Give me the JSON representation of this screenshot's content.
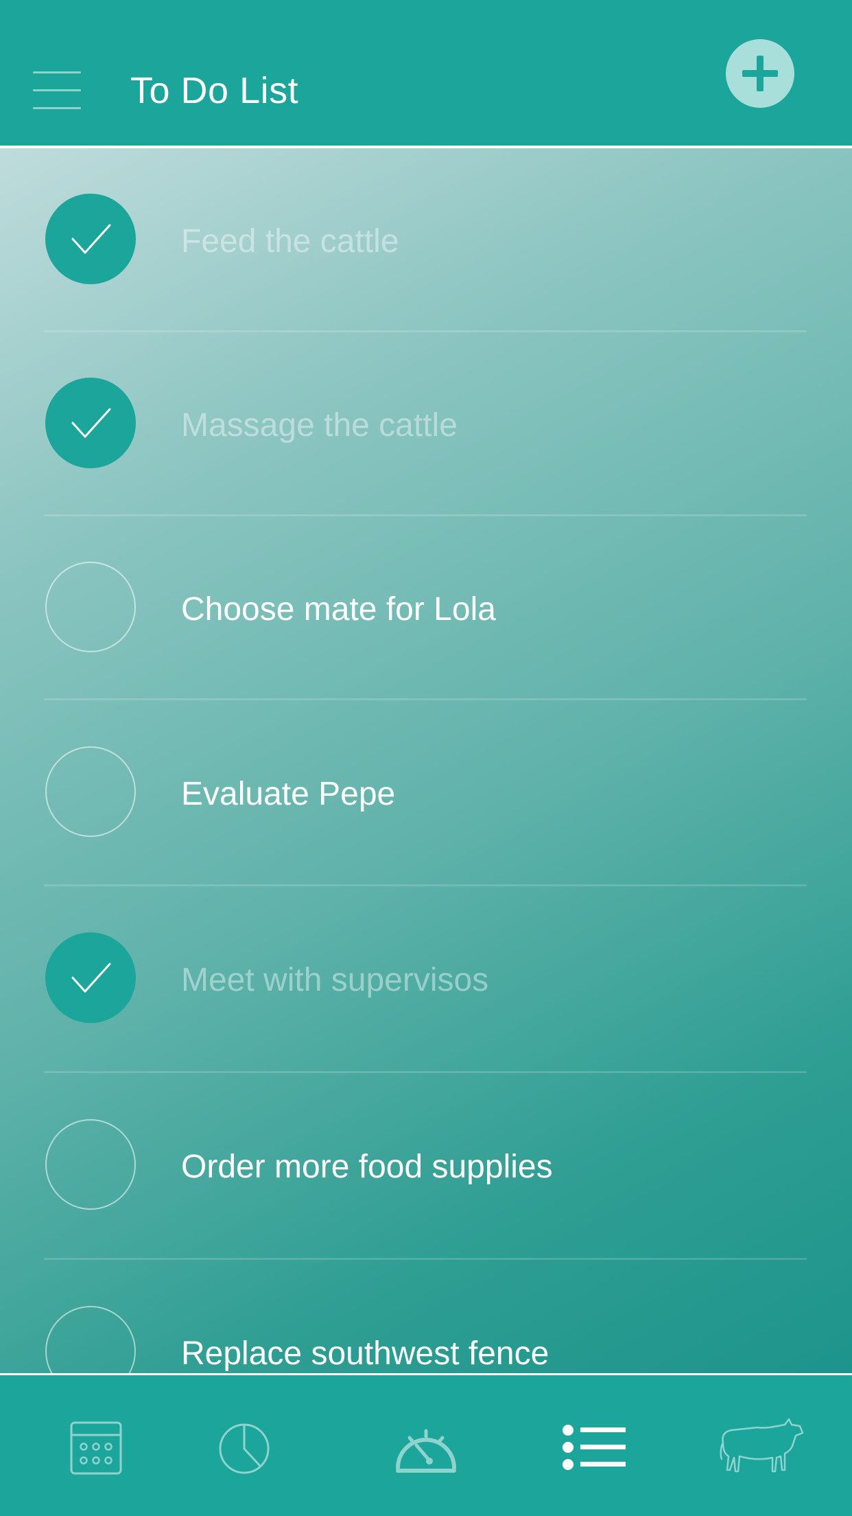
{
  "header": {
    "title": "To Do List",
    "menu_icon": "hamburger-menu-icon",
    "add_icon": "plus-icon"
  },
  "colors": {
    "primary": "#1ca59b",
    "done_check": "#1ca59b",
    "add_button_bg": "#a9dfdb",
    "inactive_tab_icon": "#8fd3ce",
    "active_tab_icon": "#ffffff"
  },
  "tasks": [
    {
      "label": "Feed the cattle",
      "done": true
    },
    {
      "label": "Massage the cattle",
      "done": true
    },
    {
      "label": "Choose mate for Lola",
      "done": false
    },
    {
      "label": "Evaluate Pepe",
      "done": false
    },
    {
      "label": "Meet with supervisos",
      "done": true
    },
    {
      "label": "Order more food supplies",
      "done": false
    },
    {
      "label": "Replace southwest fence",
      "done": false
    }
  ],
  "tabbar": {
    "tabs": [
      {
        "icon": "calendar-icon",
        "active": false
      },
      {
        "icon": "pie-chart-icon",
        "active": false
      },
      {
        "icon": "speedometer-icon",
        "active": false
      },
      {
        "icon": "list-icon",
        "active": true
      },
      {
        "icon": "cow-icon",
        "active": false
      }
    ]
  }
}
